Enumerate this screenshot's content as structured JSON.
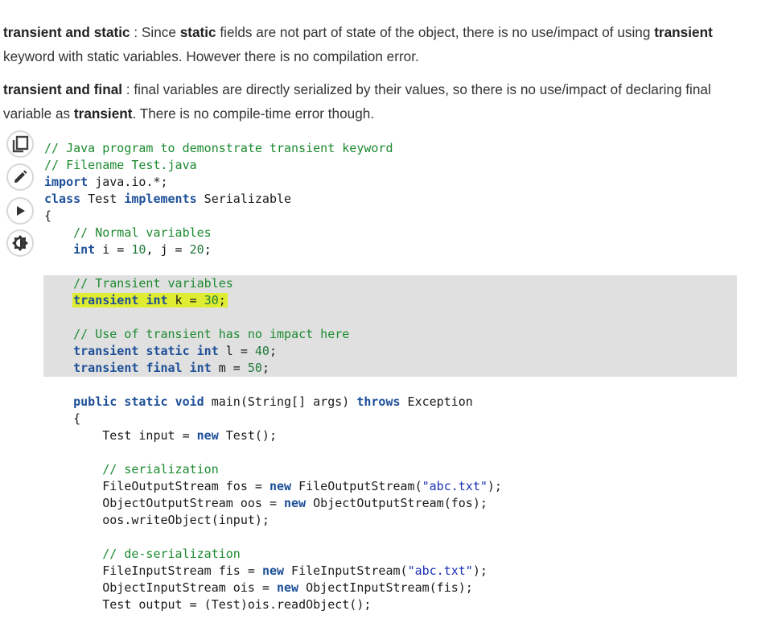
{
  "paragraphs": [
    {
      "id": "p1",
      "runs": [
        {
          "text": "transient and static",
          "bold": true
        },
        {
          "text": " : Since ",
          "bold": false
        },
        {
          "text": "static",
          "bold": true
        },
        {
          "text": " fields are not part of state of the object, there is no use/impact of using ",
          "bold": false
        },
        {
          "text": "transient",
          "bold": true
        },
        {
          "text": " keyword with static variables. However there is no compilation error.",
          "bold": false
        }
      ]
    },
    {
      "id": "p2",
      "runs": [
        {
          "text": "transient and final",
          "bold": true
        },
        {
          "text": " : final variables are directly serialized by their values, so there is no use/impact of declaring final variable as ",
          "bold": false
        },
        {
          "text": "transient",
          "bold": true
        },
        {
          "text": ". There is no compile-time error though.",
          "bold": false
        }
      ]
    }
  ],
  "toolbar": {
    "buttons": [
      {
        "name": "copy-button",
        "icon": "copy-icon"
      },
      {
        "name": "edit-button",
        "icon": "pencil-icon"
      },
      {
        "name": "run-button",
        "icon": "play-icon"
      },
      {
        "name": "theme-toggle-button",
        "icon": "brightness-icon"
      }
    ]
  },
  "code": {
    "language": "java",
    "lines": [
      {
        "hl": false,
        "tokens": [
          [
            "c",
            "// Java program to demonstrate transient keyword"
          ]
        ]
      },
      {
        "hl": false,
        "tokens": [
          [
            "c",
            "// Filename Test.java"
          ]
        ]
      },
      {
        "hl": false,
        "tokens": [
          [
            "k",
            "import"
          ],
          [
            "p",
            " java.io.*;"
          ]
        ]
      },
      {
        "hl": false,
        "tokens": [
          [
            "k",
            "class"
          ],
          [
            "p",
            " Test "
          ],
          [
            "k",
            "implements"
          ],
          [
            "p",
            " Serializable"
          ]
        ]
      },
      {
        "hl": false,
        "tokens": [
          [
            "p",
            "{"
          ]
        ]
      },
      {
        "hl": false,
        "tokens": [
          [
            "p",
            "    "
          ],
          [
            "c",
            "// Normal variables"
          ]
        ]
      },
      {
        "hl": false,
        "tokens": [
          [
            "p",
            "    "
          ],
          [
            "k",
            "int"
          ],
          [
            "p",
            " i = "
          ],
          [
            "n",
            "10"
          ],
          [
            "p",
            ", j = "
          ],
          [
            "n",
            "20"
          ],
          [
            "p",
            ";"
          ]
        ]
      },
      {
        "hl": false,
        "tokens": []
      },
      {
        "hl": true,
        "tokens": [
          [
            "p",
            "    "
          ],
          [
            "c",
            "// Transient variables"
          ]
        ]
      },
      {
        "hl": true,
        "selected": true,
        "tokens": [
          [
            "p",
            "    "
          ],
          [
            "k",
            "transient"
          ],
          [
            "p",
            " "
          ],
          [
            "k",
            "int"
          ],
          [
            "p",
            " k = "
          ],
          [
            "n",
            "30"
          ],
          [
            "p",
            ";"
          ]
        ]
      },
      {
        "hl": true,
        "tokens": []
      },
      {
        "hl": true,
        "tokens": [
          [
            "p",
            "    "
          ],
          [
            "c",
            "// Use of transient has no impact here"
          ]
        ]
      },
      {
        "hl": true,
        "tokens": [
          [
            "p",
            "    "
          ],
          [
            "k",
            "transient"
          ],
          [
            "p",
            " "
          ],
          [
            "k",
            "static"
          ],
          [
            "p",
            " "
          ],
          [
            "k",
            "int"
          ],
          [
            "p",
            " l = "
          ],
          [
            "n",
            "40"
          ],
          [
            "p",
            ";"
          ]
        ]
      },
      {
        "hl": true,
        "tokens": [
          [
            "p",
            "    "
          ],
          [
            "k",
            "transient"
          ],
          [
            "p",
            " "
          ],
          [
            "k",
            "final"
          ],
          [
            "p",
            " "
          ],
          [
            "k",
            "int"
          ],
          [
            "p",
            " m = "
          ],
          [
            "n",
            "50"
          ],
          [
            "p",
            ";"
          ]
        ]
      },
      {
        "hl": false,
        "tokens": []
      },
      {
        "hl": false,
        "tokens": [
          [
            "p",
            "    "
          ],
          [
            "k",
            "public"
          ],
          [
            "p",
            " "
          ],
          [
            "k",
            "static"
          ],
          [
            "p",
            " "
          ],
          [
            "k",
            "void"
          ],
          [
            "p",
            " main(String[] args) "
          ],
          [
            "k",
            "throws"
          ],
          [
            "p",
            " Exception"
          ]
        ]
      },
      {
        "hl": false,
        "tokens": [
          [
            "p",
            "    {"
          ]
        ]
      },
      {
        "hl": false,
        "tokens": [
          [
            "p",
            "        Test input = "
          ],
          [
            "k",
            "new"
          ],
          [
            "p",
            " Test();"
          ]
        ]
      },
      {
        "hl": false,
        "tokens": []
      },
      {
        "hl": false,
        "tokens": [
          [
            "p",
            "        "
          ],
          [
            "c",
            "// serialization"
          ]
        ]
      },
      {
        "hl": false,
        "tokens": [
          [
            "p",
            "        FileOutputStream fos = "
          ],
          [
            "k",
            "new"
          ],
          [
            "p",
            " FileOutputStream("
          ],
          [
            "s",
            "\"abc.txt\""
          ],
          [
            "p",
            ");"
          ]
        ]
      },
      {
        "hl": false,
        "tokens": [
          [
            "p",
            "        ObjectOutputStream oos = "
          ],
          [
            "k",
            "new"
          ],
          [
            "p",
            " ObjectOutputStream(fos);"
          ]
        ]
      },
      {
        "hl": false,
        "tokens": [
          [
            "p",
            "        oos.writeObject(input);"
          ]
        ]
      },
      {
        "hl": false,
        "tokens": []
      },
      {
        "hl": false,
        "tokens": [
          [
            "p",
            "        "
          ],
          [
            "c",
            "// de-serialization"
          ]
        ]
      },
      {
        "hl": false,
        "tokens": [
          [
            "p",
            "        FileInputStream fis = "
          ],
          [
            "k",
            "new"
          ],
          [
            "p",
            " FileInputStream("
          ],
          [
            "s",
            "\"abc.txt\""
          ],
          [
            "p",
            ");"
          ]
        ]
      },
      {
        "hl": false,
        "tokens": [
          [
            "p",
            "        ObjectInputStream ois = "
          ],
          [
            "k",
            "new"
          ],
          [
            "p",
            " ObjectInputStream(fis);"
          ]
        ]
      },
      {
        "hl": false,
        "tokens": [
          [
            "p",
            "        Test output = (Test)ois.readObject();"
          ]
        ]
      }
    ]
  }
}
